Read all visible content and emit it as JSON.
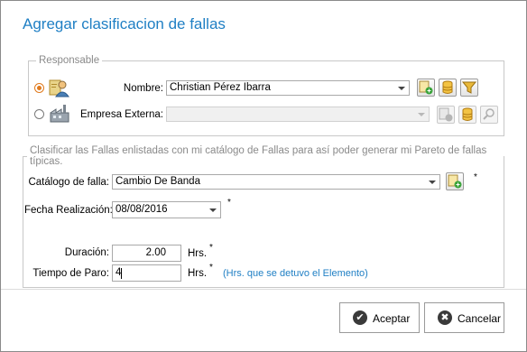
{
  "dialog": {
    "title": "Agregar clasificacion de fallas"
  },
  "responsable": {
    "legend": "Responsable",
    "nombre_label": "Nombre:",
    "nombre_value": "Christian Pérez Ibarra",
    "empresa_label": "Empresa Externa:",
    "empresa_value": "",
    "selected": "nombre"
  },
  "clasificar": {
    "legend": "Clasificar las Fallas enlistadas con mi catálogo de Fallas  para así poder generar mi Pareto de fallas típicas.",
    "catalogo_label": "Catálogo de falla:",
    "catalogo_value": "Cambio De Banda",
    "fecha_label": "Fecha Realización:",
    "fecha_value": "08/08/2016",
    "duracion_label": "Duración:",
    "duracion_value": "2.00",
    "duracion_unit": "Hrs.",
    "paro_label": "Tiempo de Paro:",
    "paro_value": "4",
    "paro_unit": "Hrs.",
    "paro_hint": "(Hrs. que se detuvo el  Elemento)",
    "required_mark": "*"
  },
  "buttons": {
    "accept": "Aceptar",
    "cancel": "Cancelar"
  },
  "colors": {
    "title": "#1f7fc4",
    "hint": "#1f7fc4",
    "radio_selected": "#e07a1c"
  }
}
